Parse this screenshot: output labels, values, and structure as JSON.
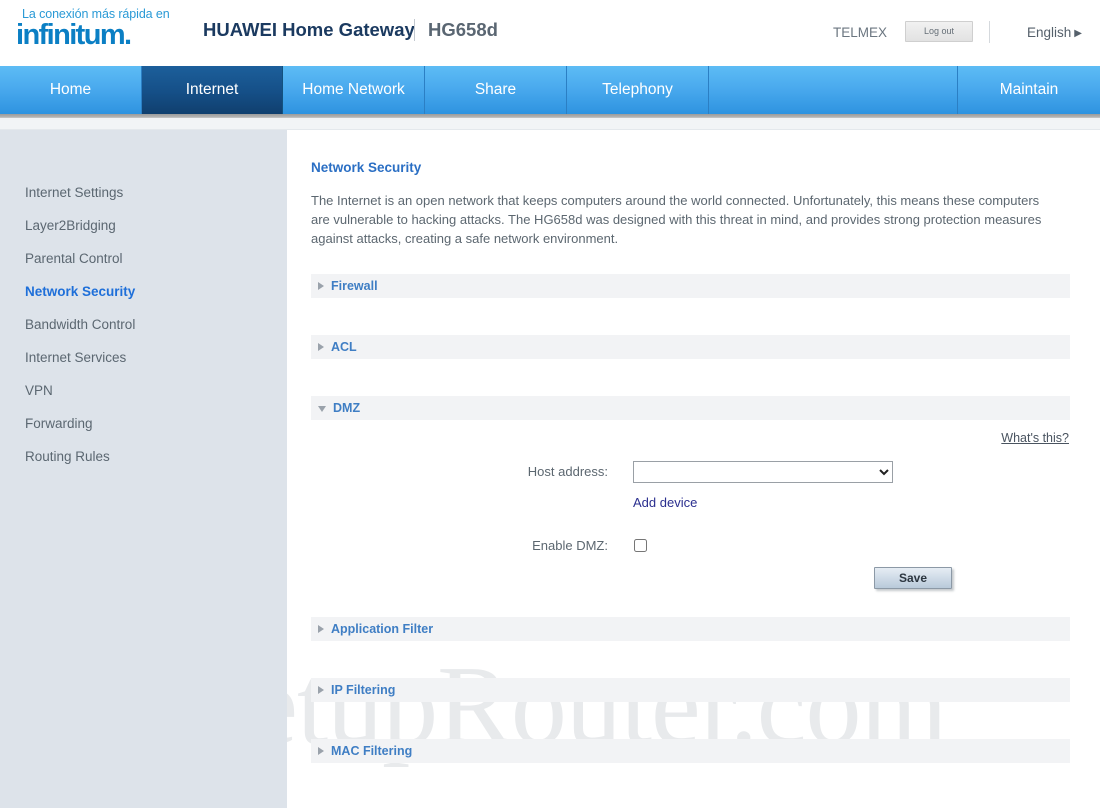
{
  "header": {
    "logo_tagline": "La conexión más rápida en",
    "logo_name": "infinitum.",
    "product_title": "HUAWEI Home Gateway",
    "product_model": "HG658d",
    "account": "TELMEX",
    "logout_label": "Log out",
    "language": "English",
    "language_caret": "▶"
  },
  "nav": {
    "items": [
      {
        "label": "Home",
        "active": false
      },
      {
        "label": "Internet",
        "active": true
      },
      {
        "label": "Home Network",
        "active": false
      },
      {
        "label": "Share",
        "active": false
      },
      {
        "label": "Telephony",
        "active": false
      },
      {
        "label": "",
        "active": false
      },
      {
        "label": "Maintain",
        "active": false
      }
    ]
  },
  "sidebar": {
    "items": [
      {
        "label": "Internet Settings",
        "active": false
      },
      {
        "label": "Layer2Bridging",
        "active": false
      },
      {
        "label": "Parental Control",
        "active": false
      },
      {
        "label": "Network Security",
        "active": true
      },
      {
        "label": "Bandwidth Control",
        "active": false
      },
      {
        "label": "Internet Services",
        "active": false
      },
      {
        "label": "VPN",
        "active": false
      },
      {
        "label": "Forwarding",
        "active": false
      },
      {
        "label": "Routing Rules",
        "active": false
      }
    ]
  },
  "main": {
    "title": "Network Security",
    "description": "The Internet is an open network that keeps computers around the world connected. Unfortunately, this means these computers are vulnerable to hacking attacks. The HG658d was designed with this threat in mind, and provides strong protection measures against attacks, creating a safe network environment.",
    "sections": {
      "firewall": "Firewall",
      "acl": "ACL",
      "dmz": "DMZ",
      "application_filter": "Application Filter",
      "ip_filtering": "IP Filtering",
      "mac_filtering": "MAC Filtering"
    },
    "dmz": {
      "whats_this": "What's this?",
      "host_address_label": "Host address:",
      "host_address_value": "",
      "add_device": "Add device",
      "enable_dmz_label": "Enable DMZ:",
      "enable_dmz_checked": false,
      "save_label": "Save"
    }
  },
  "watermark": "SetupRouter.com",
  "colors": {
    "nav_active": "#154f87",
    "nav": "#4aaaee",
    "link_blue": "#2b6fc4",
    "sidebar_bg": "#dde3ea",
    "section_bg": "#f2f3f5"
  }
}
